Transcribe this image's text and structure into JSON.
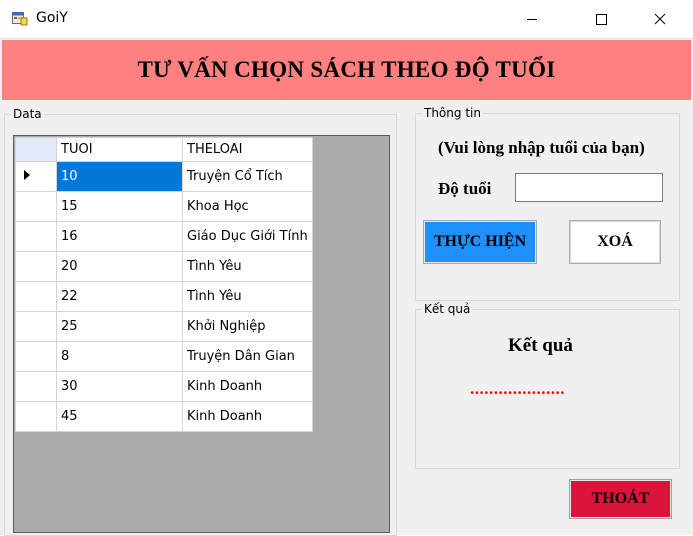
{
  "window": {
    "title": "GoiY"
  },
  "banner": {
    "title": "TƯ VẤN CHỌN SÁCH THEO ĐỘ TUỔI"
  },
  "data_group": {
    "label": "Data",
    "columns": [
      "TUOI",
      "THELOAI"
    ],
    "rows": [
      [
        "10",
        "Truyện Cổ Tích"
      ],
      [
        "15",
        "Khoa Học"
      ],
      [
        "16",
        "Giáo Dục Giới Tính"
      ],
      [
        "20",
        "Tình Yêu"
      ],
      [
        "22",
        "Tình Yêu"
      ],
      [
        "25",
        "Khởi Nghiệp"
      ],
      [
        "8",
        "Truyện Dân Gian"
      ],
      [
        "30",
        "Kinh Doanh"
      ],
      [
        "45",
        "Kinh Doanh"
      ]
    ]
  },
  "info_group": {
    "label": "Thông tin",
    "prompt": "(Vui lòng nhập tuổi của bạn)",
    "age_label": "Độ tuổi",
    "age_value": "",
    "submit_label": "THỰC HIỆN",
    "clear_label": "XOÁ"
  },
  "result_group": {
    "label": "Kết quả",
    "heading": "Kết quả",
    "value": "...................."
  },
  "exit_label": "THOÁT",
  "colors": {
    "banner": "#ff8080",
    "submit_button": "#1e90ff",
    "exit_button": "#dc143c",
    "result_dots": "#ff0000",
    "selection": "#0078d7"
  }
}
